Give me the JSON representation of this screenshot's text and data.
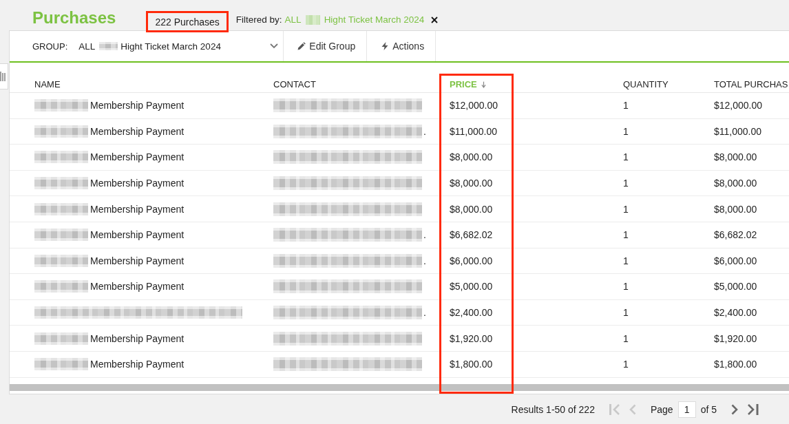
{
  "header": {
    "title": "Purchases",
    "count": {
      "text": "222 Purchases",
      "highlighted": true
    },
    "filter": {
      "label": "Filtered by:",
      "value": [
        {
          "text": "ALL"
        },
        {
          "redacted": true
        },
        {
          "text": "Hight Ticket March 2024"
        }
      ]
    }
  },
  "toolbar": {
    "group_label": "GROUP:",
    "group_value": [
      {
        "text": "ALL"
      },
      {
        "redacted": true
      },
      {
        "text": "Hight Ticket March 2024"
      }
    ],
    "buttons": [
      {
        "label": "Edit Group",
        "kind": "edit"
      },
      {
        "label": "Actions",
        "kind": "actions"
      }
    ]
  },
  "table": {
    "columns": [
      {
        "label": "NAME",
        "sorted": false,
        "highlighted": false
      },
      {
        "label": "CONTACT",
        "sorted": false,
        "highlighted": false
      },
      {
        "label": "PRICE",
        "sorted": true,
        "highlighted": true
      },
      {
        "label": "QUANTITY",
        "sorted": false,
        "highlighted": false
      },
      {
        "label": "TOTAL PURCHAS",
        "sorted": false,
        "highlighted": false
      }
    ],
    "rows": [
      {
        "name": {
          "redacted": true,
          "text": "Membership Payment"
        },
        "contact": {
          "redacted": true
        },
        "price": "$12,000.00",
        "quantity": "1",
        "total": "$12,000.00"
      },
      {
        "name": {
          "redacted": true,
          "text": "Membership Payment"
        },
        "contact": {
          "redacted": true,
          "tail": "."
        },
        "price": "$11,000.00",
        "quantity": "1",
        "total": "$11,000.00"
      },
      {
        "name": {
          "redacted": true,
          "text": "Membership Payment"
        },
        "contact": {
          "redacted": true
        },
        "price": "$8,000.00",
        "quantity": "1",
        "total": "$8,000.00"
      },
      {
        "name": {
          "redacted": true,
          "text": "Membership Payment"
        },
        "contact": {
          "redacted": true
        },
        "price": "$8,000.00",
        "quantity": "1",
        "total": "$8,000.00"
      },
      {
        "name": {
          "redacted": true,
          "text": "Membership Payment"
        },
        "contact": {
          "redacted": true
        },
        "price": "$8,000.00",
        "quantity": "1",
        "total": "$8,000.00"
      },
      {
        "name": {
          "redacted": true,
          "text": "Membership Payment"
        },
        "contact": {
          "redacted": true,
          "tail": "."
        },
        "price": "$6,682.02",
        "quantity": "1",
        "total": "$6,682.02"
      },
      {
        "name": {
          "redacted": true,
          "text": "Membership Payment"
        },
        "contact": {
          "redacted": true,
          "tail": "."
        },
        "price": "$6,000.00",
        "quantity": "1",
        "total": "$6,000.00"
      },
      {
        "name": {
          "redacted": true,
          "text": "Membership Payment"
        },
        "contact": {
          "redacted": true
        },
        "price": "$5,000.00",
        "quantity": "1",
        "total": "$5,000.00"
      },
      {
        "name": {
          "redacted": true
        },
        "contact": {
          "redacted": true,
          "tail": "."
        },
        "price": "$2,400.00",
        "quantity": "1",
        "total": "$2,400.00"
      },
      {
        "name": {
          "redacted": true,
          "text": "Membership Payment"
        },
        "contact": {
          "redacted": true
        },
        "price": "$1,920.00",
        "quantity": "1",
        "total": "$1,920.00"
      },
      {
        "name": {
          "redacted": true,
          "text": "Membership Payment"
        },
        "contact": {
          "redacted": true
        },
        "price": "$1,800.00",
        "quantity": "1",
        "total": "$1,800.00"
      }
    ]
  },
  "footer": {
    "results": "Results 1-50 of 222",
    "pager": {
      "first": {
        "disabled": true
      },
      "prev": {
        "disabled": true
      },
      "page_label": "Page",
      "page_value": "1",
      "page_total": "of 5",
      "next": {
        "disabled": false
      },
      "last": {
        "disabled": false
      }
    }
  }
}
